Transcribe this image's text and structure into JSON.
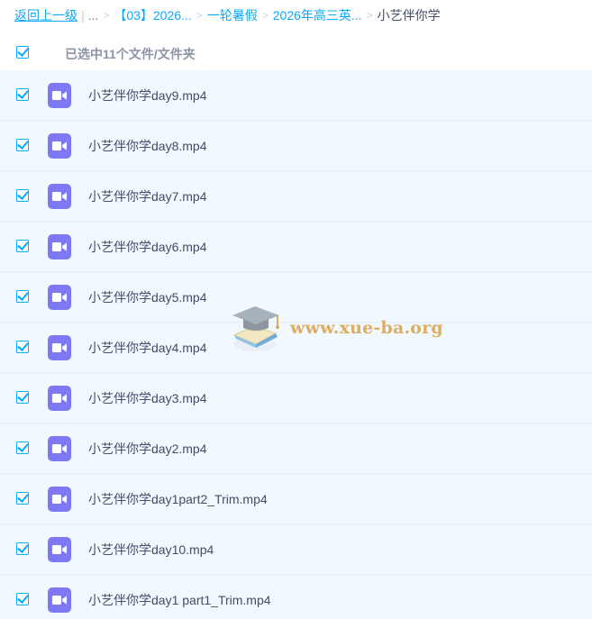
{
  "breadcrumb": {
    "back": "返回上一级",
    "ellipsis": "...",
    "crumbs": [
      "【03】2026...",
      "一轮暑假",
      "2026年高三英..."
    ],
    "current": "小艺伴你学"
  },
  "selection": {
    "label": "已选中11个文件/文件夹"
  },
  "files": [
    {
      "name": "小艺伴你学day9.mp4"
    },
    {
      "name": "小艺伴你学day8.mp4"
    },
    {
      "name": "小艺伴你学day7.mp4"
    },
    {
      "name": "小艺伴你学day6.mp4"
    },
    {
      "name": "小艺伴你学day5.mp4"
    },
    {
      "name": "小艺伴你学day4.mp4"
    },
    {
      "name": "小艺伴你学day3.mp4"
    },
    {
      "name": "小艺伴你学day2.mp4"
    },
    {
      "name": "小艺伴你学day1part2_Trim.mp4"
    },
    {
      "name": "小艺伴你学day10.mp4"
    },
    {
      "name": "小艺伴你学day1 part1_Trim.mp4"
    }
  ],
  "watermark": {
    "text": "www.xue-ba.org"
  },
  "icons": {
    "file_type": "video-file-icon",
    "checkbox": "checkmark-icon"
  },
  "colors": {
    "accent": "#09aaff",
    "video_icon": "#7e79f2",
    "row_background": "#f1f8fe",
    "text": "#424e67",
    "watermark": "#d9a24a"
  }
}
